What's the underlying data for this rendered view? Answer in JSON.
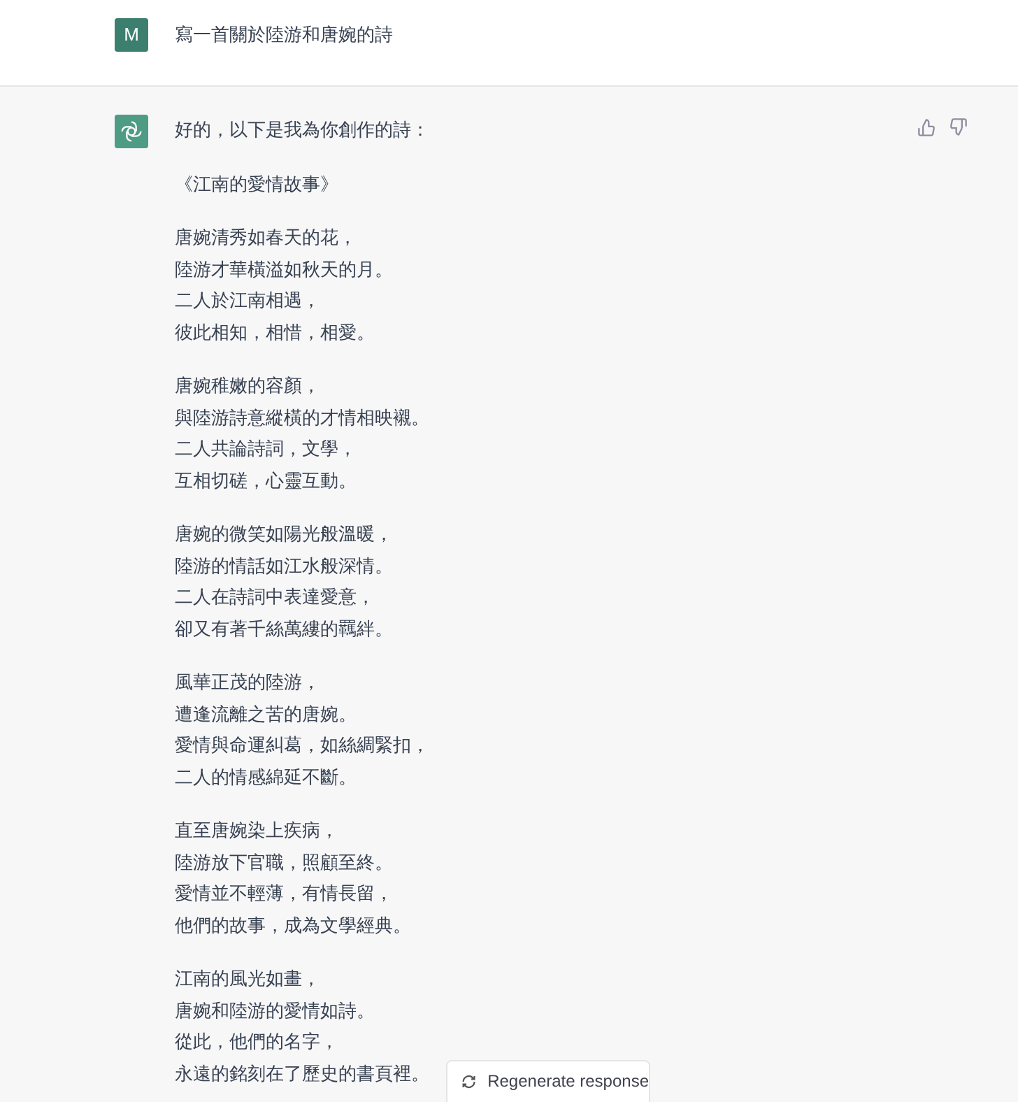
{
  "user_message": {
    "avatar": "M",
    "text": "寫一首關於陸游和唐婉的詩"
  },
  "assistant_message": {
    "intro": "好的，以下是我為你創作的詩：",
    "poem_title": "《江南的愛情故事》",
    "stanzas": [
      [
        "唐婉清秀如春天的花，",
        "陸游才華橫溢如秋天的月。",
        "二人於江南相遇，",
        "彼此相知，相惜，相愛。"
      ],
      [
        "唐婉稚嫩的容顏，",
        "與陸游詩意縱橫的才情相映襯。",
        "二人共論詩詞，文學，",
        "互相切磋，心靈互動。"
      ],
      [
        "唐婉的微笑如陽光般溫暖，",
        "陸游的情話如江水般深情。",
        "二人在詩詞中表達愛意，",
        "卻又有著千絲萬縷的羈絆。"
      ],
      [
        "風華正茂的陸游，",
        "遭逢流離之苦的唐婉。",
        "愛情與命運糾葛，如絲綢緊扣，",
        "二人的情感綿延不斷。"
      ],
      [
        "直至唐婉染上疾病，",
        "陸游放下官職，照顧至終。",
        "愛情並不輕薄，有情長留，",
        "他們的故事，成為文學經典。"
      ],
      [
        "江南的風光如畫，",
        "唐婉和陸游的愛情如詩。",
        "從此，他們的名字，",
        "永遠的銘刻在了歷史的書頁裡。"
      ]
    ]
  },
  "regenerate_button": {
    "label": "Regenerate response"
  }
}
